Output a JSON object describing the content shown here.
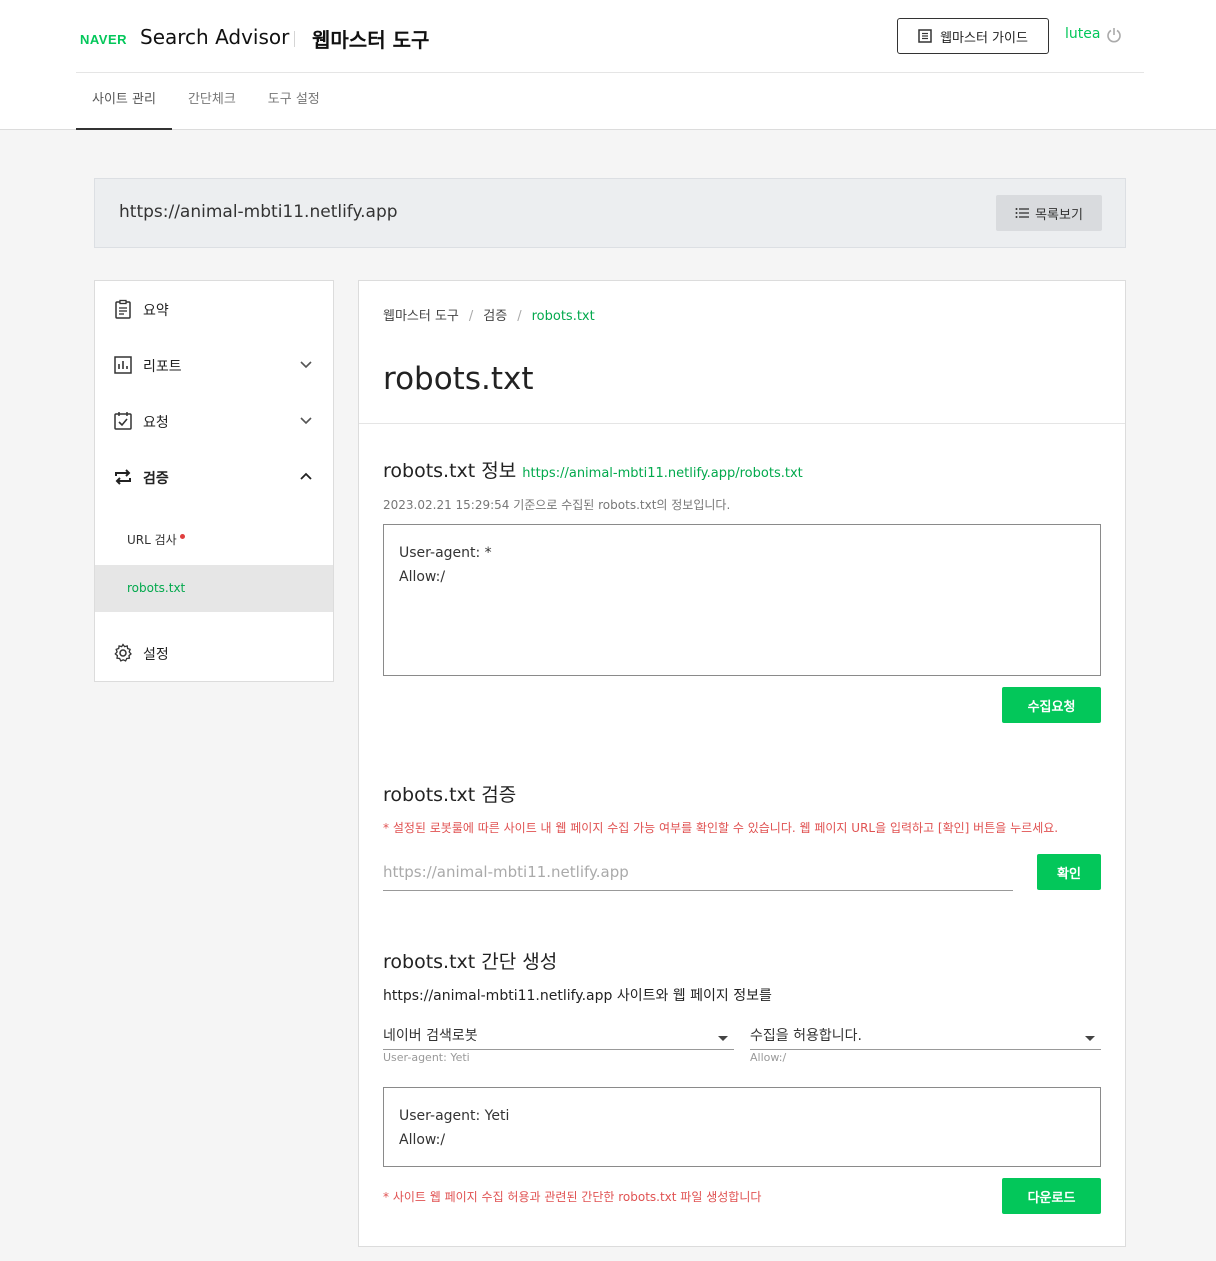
{
  "header": {
    "logo": "NAVER",
    "brand": "Search Advisor",
    "product": "웹마스터 도구",
    "guide_button": "웹마스터 가이드",
    "user": "lutea"
  },
  "nav": {
    "tabs": [
      "사이트 관리",
      "간단체크",
      "도구 설정"
    ]
  },
  "site": {
    "url": "https://animal-mbti11.netlify.app",
    "list_button": "목록보기"
  },
  "sidebar": {
    "summary": "요약",
    "report": "리포트",
    "request": "요청",
    "verify": "검증",
    "url_check": "URL 검사",
    "robots": "robots.txt",
    "settings": "설정"
  },
  "breadcrumb": {
    "root": "웹마스터 도구",
    "mid": "검증",
    "current": "robots.txt",
    "sep": "/"
  },
  "page": {
    "title": "robots.txt"
  },
  "info": {
    "title": "robots.txt 정보",
    "link": "https://animal-mbti11.netlify.app/robots.txt",
    "meta": "2023.02.21 15:29:54 기준으로 수집된 robots.txt의 정보입니다.",
    "line1": "User-agent: *",
    "line2": "Allow:/",
    "button": "수집요청"
  },
  "verify": {
    "title": "robots.txt 검증",
    "notice": "* 설정된 로봇룰에 따른 사이트 내 웹 페이지 수집 가능 여부를 확인할 수 있습니다. 웹 페이지 URL을 입력하고 [확인] 버튼을 누르세요.",
    "placeholder": "https://animal-mbti11.netlify.app",
    "button": "확인"
  },
  "generate": {
    "title": "robots.txt 간단 생성",
    "desc": "https://animal-mbti11.netlify.app 사이트와 웹 페이지 정보를",
    "select1": "네이버 검색로봇",
    "hint1": "User-agent: Yeti",
    "select2": "수집을 허용합니다.",
    "hint2": "Allow:/",
    "line1": "User-agent: Yeti",
    "line2": "Allow:/",
    "notice": "* 사이트 웹 페이지 수집 허용과 관련된 간단한 robots.txt 파일 생성합니다",
    "button": "다운로드"
  },
  "colors": {
    "accent": "#03c75a",
    "notice": "#e05252"
  }
}
